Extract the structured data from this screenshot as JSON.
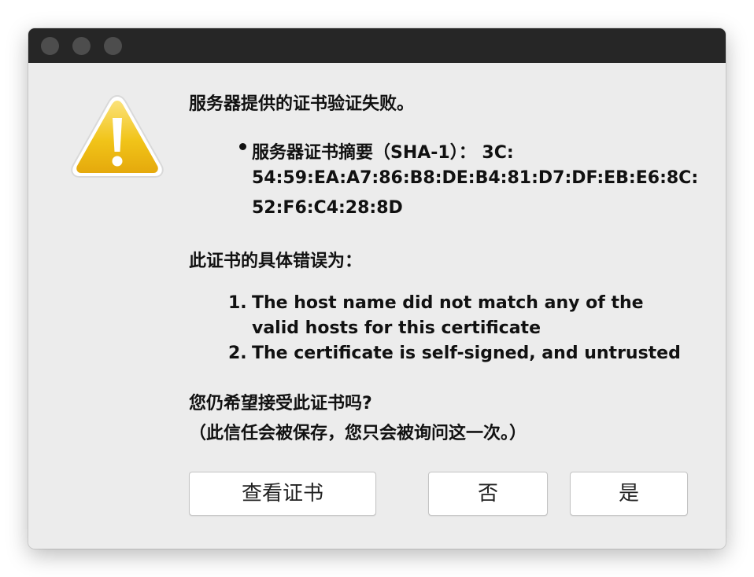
{
  "dialog": {
    "heading": "服务器提供的证书验证失败。",
    "fingerprint_lines": [
      "服务器证书摘要（SHA-1）：  3C:",
      "54:59:EA:A7:86:B8:DE:B4:81:D7:DF:EB:E6:8C:",
      "52:F6:C4:28:8D"
    ],
    "error_heading": "此证书的具体错误为：",
    "errors": [
      {
        "number": "1.",
        "lines": [
          "The host name did not match any of the",
          "valid hosts for this certificate"
        ]
      },
      {
        "number": "2.",
        "lines": [
          "The certificate is self-signed, and untrusted"
        ]
      }
    ],
    "question": "您仍希望接受此证书吗?",
    "note": "（此信任会被保存，您只会被询问这一次。）"
  },
  "buttons": {
    "view_certificate": "查看证书",
    "no": "否",
    "yes": "是"
  },
  "icons": {
    "warning": "warning-triangle-icon"
  },
  "colors": {
    "titlebar": "#262626",
    "window_background": "#ececec",
    "warning_yellow": "#f2c21a"
  }
}
